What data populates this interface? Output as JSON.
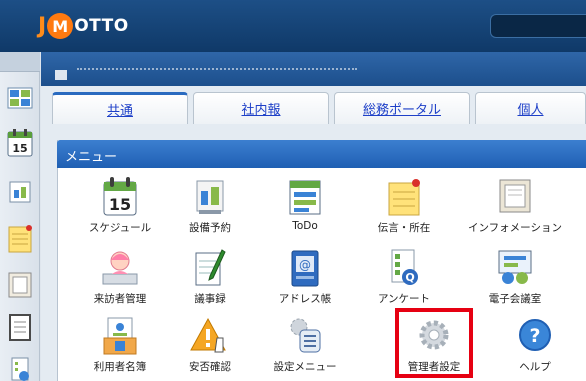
{
  "app": {
    "logo_j": "J",
    "logo_mid": "M",
    "logo_text": "OTTO"
  },
  "tabs": [
    {
      "label": "共通"
    },
    {
      "label": "社内報"
    },
    {
      "label": "総務ポータル"
    },
    {
      "label": "個人"
    }
  ],
  "menu": {
    "title": "メニュー",
    "items": [
      {
        "label": "スケジュール",
        "icon": "calendar-icon"
      },
      {
        "label": "設備予約",
        "icon": "facility-reservation-icon"
      },
      {
        "label": "ToDo",
        "icon": "todo-list-icon"
      },
      {
        "label": "伝言・所在",
        "icon": "message-note-icon"
      },
      {
        "label": "インフォメーション",
        "icon": "information-board-icon"
      },
      {
        "label": "来訪者管理",
        "icon": "visitor-reception-icon"
      },
      {
        "label": "議事録",
        "icon": "minutes-pen-icon"
      },
      {
        "label": "アドレス帳",
        "icon": "address-book-icon"
      },
      {
        "label": "アンケート",
        "icon": "survey-icon"
      },
      {
        "label": "電子会議室",
        "icon": "conference-room-icon"
      },
      {
        "label": "利用者名簿",
        "icon": "user-directory-icon"
      },
      {
        "label": "安否確認",
        "icon": "safety-confirmation-icon"
      },
      {
        "label": "設定メニュー",
        "icon": "settings-menu-icon"
      },
      {
        "label": "管理者設定",
        "icon": "admin-gear-icon"
      },
      {
        "label": "ヘルプ",
        "icon": "help-icon"
      }
    ]
  },
  "calendar_day": "15",
  "sidebar_calendar_day": "15",
  "colors": {
    "header": "#1d4f86",
    "tab_link": "#1e40c8",
    "menu_header": "#2f6fc2",
    "highlight": "#e60012"
  }
}
